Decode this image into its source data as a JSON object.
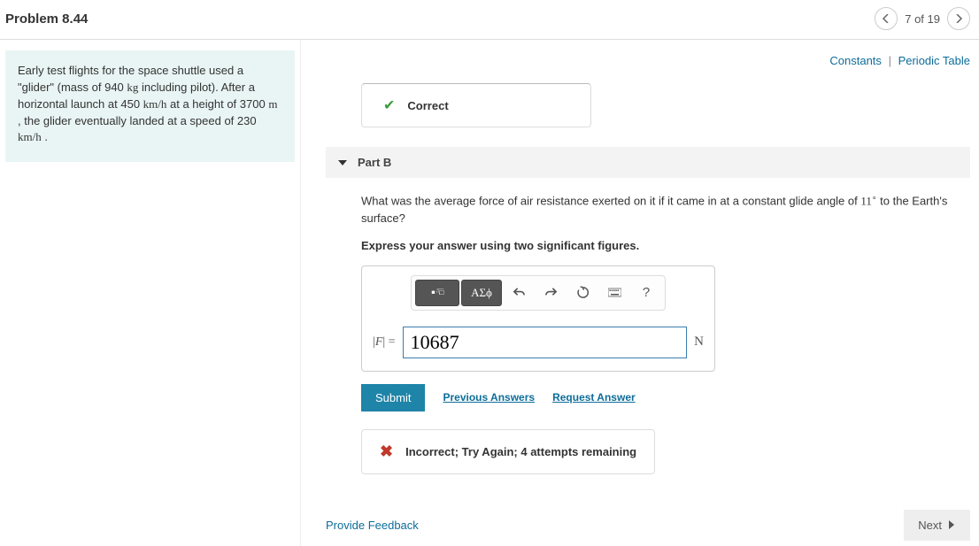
{
  "header": {
    "title": "Problem 8.44",
    "page_counter": "7 of 19"
  },
  "problem": {
    "t1": "Early test flights for the space shuttle used a \"glider\" (mass of 940 ",
    "u1": "kg",
    "t2": " including pilot). After a horizontal launch at 450 ",
    "u2": "km/h",
    "t3": " at a height of 3700 ",
    "u3": "m",
    "t4": " , the glider eventually landed at a speed of 230 ",
    "u4": "km/h",
    "t5": " ."
  },
  "links": {
    "constants": "Constants",
    "periodic": "Periodic Table"
  },
  "partA": {
    "status": "Correct"
  },
  "partB": {
    "label": "Part B",
    "q1": "What was the average force of air resistance exerted on it if it came in at a constant glide angle of ",
    "angle": "11",
    "q2": " to the Earth's surface?",
    "instruction": "Express your answer using two significant figures.",
    "greek_btn": "ΑΣϕ",
    "help_btn": "?",
    "var_label": "|F| =",
    "answer_value": "10687",
    "unit": "N",
    "submit": "Submit",
    "prev_answers": "Previous Answers",
    "request_answer": "Request Answer",
    "incorrect": "Incorrect; Try Again; 4 attempts remaining"
  },
  "footer": {
    "feedback": "Provide Feedback",
    "next": "Next"
  }
}
